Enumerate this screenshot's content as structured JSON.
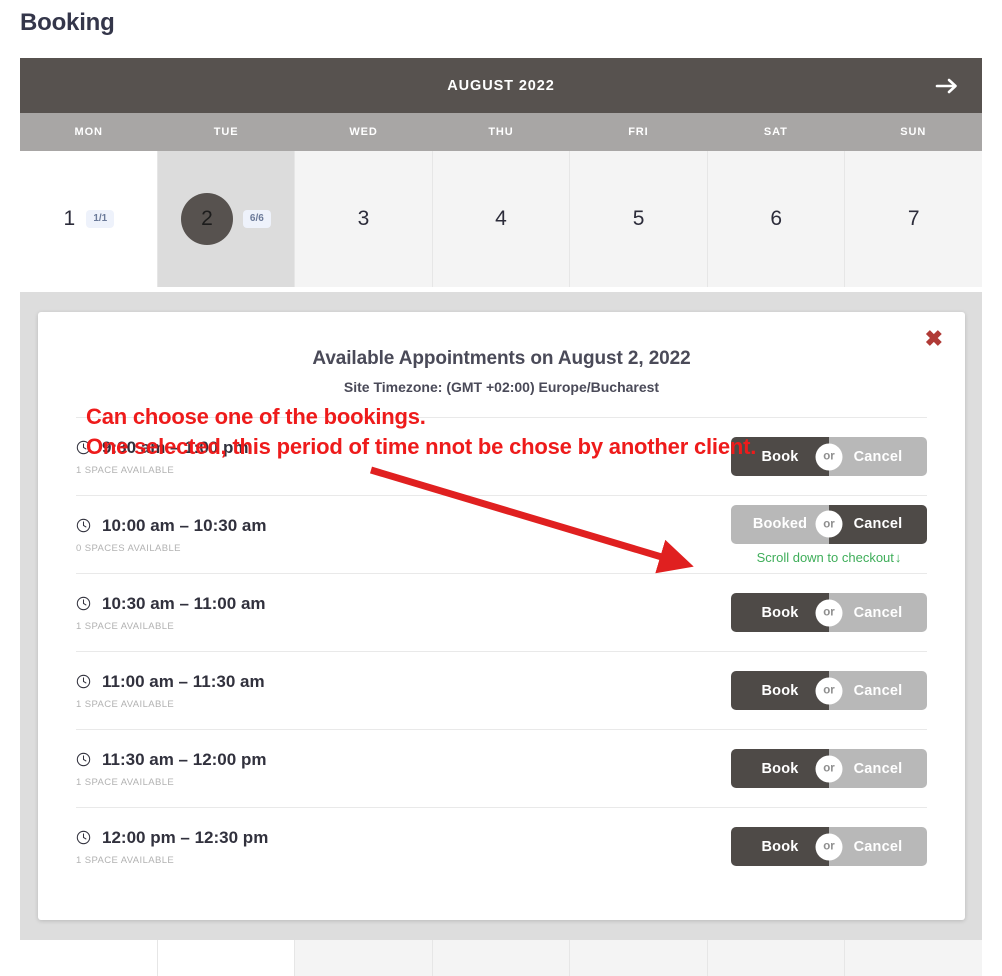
{
  "page": {
    "title": "Booking"
  },
  "calendar": {
    "month_label": "AUGUST 2022",
    "next_icon": "arrow-right-icon",
    "day_headers": [
      "MON",
      "TUE",
      "WED",
      "THU",
      "FRI",
      "SAT",
      "SUN"
    ],
    "days": [
      {
        "number": "1",
        "badge": "1/1",
        "state": "today"
      },
      {
        "number": "2",
        "badge": "6/6",
        "state": "selected"
      },
      {
        "number": "3",
        "badge": "",
        "state": "normal"
      },
      {
        "number": "4",
        "badge": "",
        "state": "normal"
      },
      {
        "number": "5",
        "badge": "",
        "state": "normal"
      },
      {
        "number": "6",
        "badge": "",
        "state": "normal"
      },
      {
        "number": "7",
        "badge": "",
        "state": "normal"
      }
    ]
  },
  "modal": {
    "close_icon": "close-icon",
    "close_label": "✖",
    "title": "Available Appointments on August 2, 2022",
    "subtitle": "Site Timezone: (GMT +02:00) Europe/Bucharest",
    "or_label": "or",
    "book_label": "Book",
    "booked_label": "Booked",
    "cancel_label": "Cancel",
    "checkout_hint": "Scroll down to checkout",
    "checkout_arrow": "↓",
    "clock_icon": "clock-icon",
    "slots": [
      {
        "time": "9:30 am – 1:00 pm",
        "spaces": "1 SPACE AVAILABLE",
        "primary_label": "Book",
        "secondary_label": "Cancel",
        "booked": false,
        "hint": ""
      },
      {
        "time": "10:00 am – 10:30 am",
        "spaces": "0 SPACES AVAILABLE",
        "primary_label": "Booked",
        "secondary_label": "Cancel",
        "booked": true,
        "hint": "Scroll down to checkout"
      },
      {
        "time": "10:30 am – 11:00 am",
        "spaces": "1 SPACE AVAILABLE",
        "primary_label": "Book",
        "secondary_label": "Cancel",
        "booked": false,
        "hint": ""
      },
      {
        "time": "11:00 am – 11:30 am",
        "spaces": "1 SPACE AVAILABLE",
        "primary_label": "Book",
        "secondary_label": "Cancel",
        "booked": false,
        "hint": ""
      },
      {
        "time": "11:30 am – 12:00 pm",
        "spaces": "1 SPACE AVAILABLE",
        "primary_label": "Book",
        "secondary_label": "Cancel",
        "booked": false,
        "hint": ""
      },
      {
        "time": "12:00 pm – 12:30 pm",
        "spaces": "1 SPACE AVAILABLE",
        "primary_label": "Book",
        "secondary_label": "Cancel",
        "booked": false,
        "hint": ""
      }
    ]
  },
  "annotations": {
    "line_1": "Can choose one of the bookings.",
    "line_2": "One selected, this period of time nnot be chose by another client.",
    "arrow_icon": "red-arrow-icon"
  },
  "colors": {
    "month_bar": "#57524f",
    "dow_bar": "#a8a6a5",
    "selected_day": "#dcdcdc",
    "badge_bg": "#eef2fb",
    "badge_text": "#6b7a99",
    "dark_button": "#4e4a47",
    "light_button": "#b8b8b8",
    "close_red": "#b03a36",
    "annotation_red": "#ee1b1b",
    "checkout_green": "#3fae5a",
    "backdrop": "#dddddd",
    "title_text": "#34364a"
  }
}
